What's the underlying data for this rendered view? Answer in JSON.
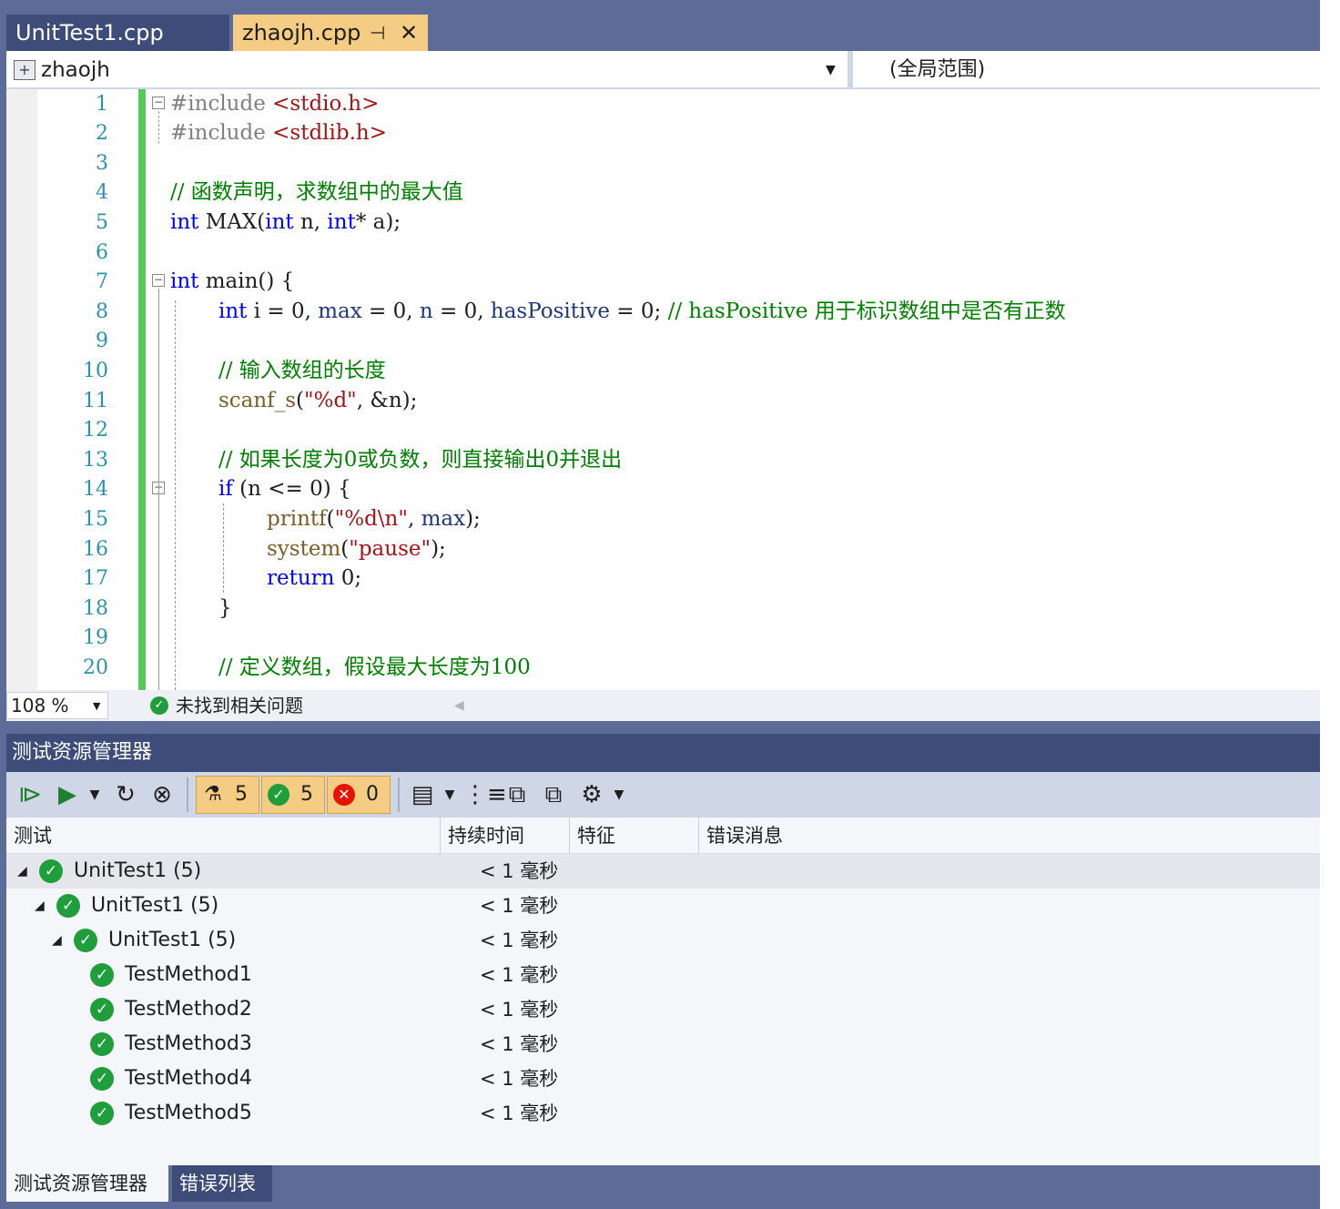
{
  "tabs": [
    {
      "label": "UnitTest1.cpp",
      "active": false
    },
    {
      "label": "zhaojh.cpp",
      "active": true
    }
  ],
  "tab_icons": {
    "pin": "pin-icon",
    "close": "close-icon"
  },
  "navbar": {
    "left": "zhaojh",
    "right": "(全局范围)"
  },
  "editor": {
    "line_numbers": [
      "1",
      "2",
      "3",
      "4",
      "5",
      "6",
      "7",
      "8",
      "9",
      "10",
      "11",
      "12",
      "13",
      "14",
      "15",
      "16",
      "17",
      "18",
      "19",
      "20"
    ],
    "code": {
      "l1_inc": "#include",
      "l1_hdr": " <stdio.h>",
      "l2_inc": "#include",
      "l2_hdr": " <stdlib.h>",
      "l4": "// 函数声明，求数组中的最大值",
      "l5_a": "int",
      "l5_b": " MAX(",
      "l5_c": "int",
      "l5_d": " n, ",
      "l5_e": "int",
      "l5_f": "* a);",
      "l7_a": "int",
      "l7_b": " main() {",
      "l8_a": "int",
      "l8_b": " i = 0, ",
      "l8_c": "max",
      "l8_d": " = 0, ",
      "l8_e": "n",
      "l8_f": " = 0, ",
      "l8_g": "hasPositive",
      "l8_h": " = 0; ",
      "l8_i": "// hasPositive 用于标识数组中是否有正数",
      "l10": "// 输入数组的长度",
      "l11_a": "scanf_s",
      "l11_b": "(",
      "l11_c": "\"%d\"",
      "l11_d": ", &n);",
      "l13": "// 如果长度为0或负数，则直接输出0并退出",
      "l14_a": "if",
      "l14_b": " (n <= 0) {",
      "l15_a": "printf",
      "l15_b": "(",
      "l15_c": "\"%d\\n\"",
      "l15_d": ", ",
      "l15_e": "max",
      "l15_f": ");",
      "l16_a": "system",
      "l16_b": "(",
      "l16_c": "\"pause\"",
      "l16_d": ");",
      "l17_a": "return",
      "l17_b": " 0;",
      "l18": "}",
      "l20": "// 定义数组，假设最大长度为100"
    }
  },
  "editor_status": {
    "zoom": "108 %",
    "message": "未找到相关问题"
  },
  "test_explorer": {
    "title": "测试资源管理器",
    "toolbar": {
      "total": "5",
      "passed": "5",
      "failed": "0"
    },
    "columns": [
      "测试",
      "持续时间",
      "特征",
      "错误消息"
    ],
    "rows": [
      {
        "name": "UnitTest1  (5)",
        "duration": "< 1 毫秒"
      },
      {
        "name": "UnitTest1  (5)",
        "duration": "< 1 毫秒"
      },
      {
        "name": "UnitTest1  (5)",
        "duration": "< 1 毫秒"
      },
      {
        "name": "TestMethod1",
        "duration": "< 1 毫秒"
      },
      {
        "name": "TestMethod2",
        "duration": "< 1 毫秒"
      },
      {
        "name": "TestMethod3",
        "duration": "< 1 毫秒"
      },
      {
        "name": "TestMethod4",
        "duration": "< 1 毫秒"
      },
      {
        "name": "TestMethod5",
        "duration": "< 1 毫秒"
      }
    ]
  },
  "bottom_tabs": [
    "测试资源管理器",
    "错误列表"
  ],
  "colors": {
    "accent": "#f5cc84",
    "chrome": "#5d6b99",
    "pass": "#1f9e3b",
    "fail": "#e51400"
  }
}
